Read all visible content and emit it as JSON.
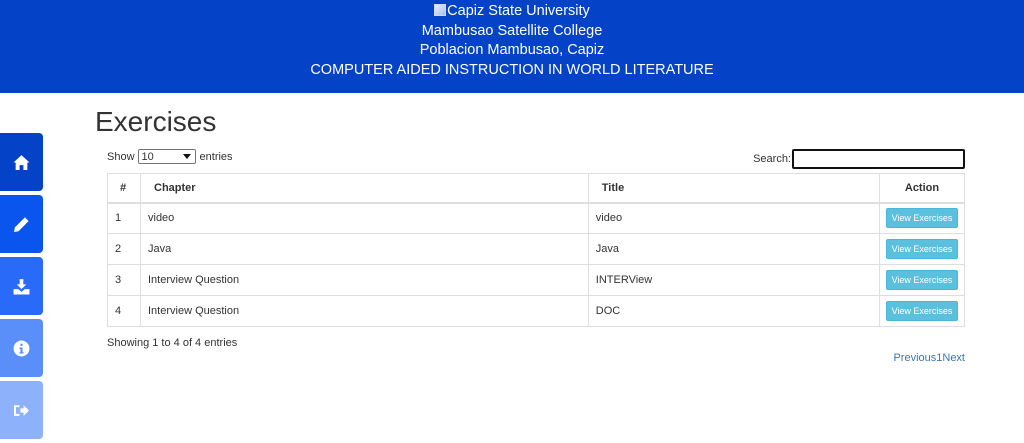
{
  "header": {
    "logo_alt": "Capiz State University",
    "line2": "Mambusao Satellite College",
    "line3": "Poblacion Mambusao, Capiz",
    "line4": "COMPUTER AIDED INSTRUCTION IN WORLD LITERATURE"
  },
  "sidebar": {
    "items": [
      {
        "icon": "home-icon"
      },
      {
        "icon": "pencil-icon"
      },
      {
        "icon": "download-icon"
      },
      {
        "icon": "info-icon"
      },
      {
        "icon": "sign-out-icon"
      }
    ]
  },
  "page": {
    "title": "Exercises",
    "length_prefix": "Show",
    "length_value": "10",
    "length_suffix": "entries",
    "search_label": "Search:",
    "search_value": ""
  },
  "table": {
    "headers": [
      "#",
      "Chapter",
      "Title",
      "Action"
    ],
    "rows": [
      {
        "num": "1",
        "chapter": "video",
        "title": "video",
        "action": "View Exercises"
      },
      {
        "num": "2",
        "chapter": "Java",
        "title": "Java",
        "action": "View Exercises"
      },
      {
        "num": "3",
        "chapter": "Interview Question",
        "title": "INTERView",
        "action": "View Exercises"
      },
      {
        "num": "4",
        "chapter": "Interview Question",
        "title": "DOC",
        "action": "View Exercises"
      }
    ]
  },
  "footer": {
    "info": "Showing 1 to 4 of 4 entries",
    "previous": "Previous",
    "page": "1",
    "next": "Next"
  },
  "colors": {
    "header_bg": "#0443c8",
    "button_bg": "#5bc0de",
    "link": "#337ab7"
  }
}
